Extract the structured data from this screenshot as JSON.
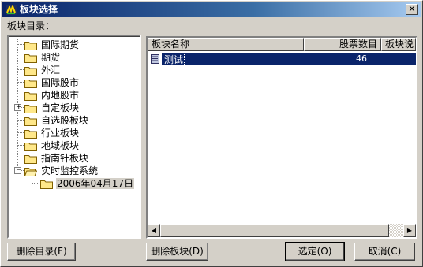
{
  "window": {
    "title": "板块选择",
    "close_glyph": "✕"
  },
  "tree": {
    "label": "板块目录：",
    "items": [
      {
        "label": "国际期货"
      },
      {
        "label": "期货"
      },
      {
        "label": "外汇"
      },
      {
        "label": "国际股市"
      },
      {
        "label": "内地股市"
      },
      {
        "label": "自定板块",
        "expander": "+"
      },
      {
        "label": "自选股板块"
      },
      {
        "label": "行业板块"
      },
      {
        "label": "地域板块"
      },
      {
        "label": "指南针板块"
      },
      {
        "label": "实时监控系统",
        "expander": "−"
      },
      {
        "label": "2006年04月17日",
        "selected": true
      }
    ]
  },
  "list": {
    "columns": [
      "板块名称",
      "股票数目",
      "板块说"
    ],
    "rows": [
      {
        "name": "测试",
        "count": "46",
        "desc": ""
      }
    ],
    "selection_color": "#0a246a"
  },
  "buttons": {
    "delete_dir": "删除目录(F)",
    "delete_block": "删除板块(D)",
    "ok": "选定(O)",
    "cancel": "取消(C)"
  },
  "scrollbar": {
    "left_arrow": "◀",
    "right_arrow": "▶"
  }
}
